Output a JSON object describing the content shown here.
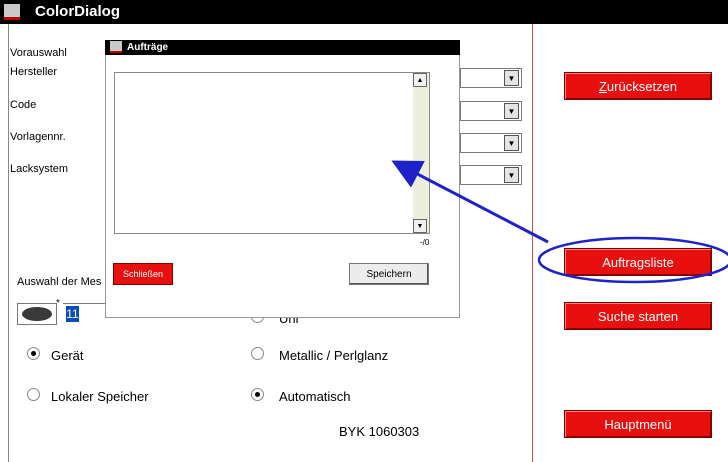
{
  "window": {
    "title": "ColorDialog"
  },
  "left_panel": {
    "preselect_label": "Vorauswahl",
    "fields": [
      {
        "label": "Hersteller"
      },
      {
        "label": "Code"
      },
      {
        "label": "Vorlagennr."
      },
      {
        "label": "Lacksystem"
      }
    ],
    "measurement_label": "Auswahl der Mes",
    "measurement_value": "11",
    "source_options": [
      {
        "label": "Gerät",
        "selected": true
      },
      {
        "label": "Lokaler Speicher",
        "selected": false
      }
    ],
    "type_options": [
      {
        "label": "Uni",
        "selected": false
      },
      {
        "label": "Metallic / Perlglanz",
        "selected": false
      },
      {
        "label": "Automatisch",
        "selected": true
      }
    ],
    "code_text": "BYK 1060303"
  },
  "right_panel": {
    "reset_label_accel": "Z",
    "reset_label_rest": "urücksetzen",
    "orderlist_label": "Auftragsliste",
    "search_label": "Suche starten",
    "mainmenu_label": "Hauptmenü"
  },
  "dialog": {
    "title": "Aufträge",
    "counter": "-/0",
    "close_label": "Schließen",
    "save_label": "Speichern"
  },
  "colors": {
    "accent_red": "#e8100e",
    "annotation_blue": "#1f22c8",
    "selection_blue": "#0a4fb3"
  }
}
